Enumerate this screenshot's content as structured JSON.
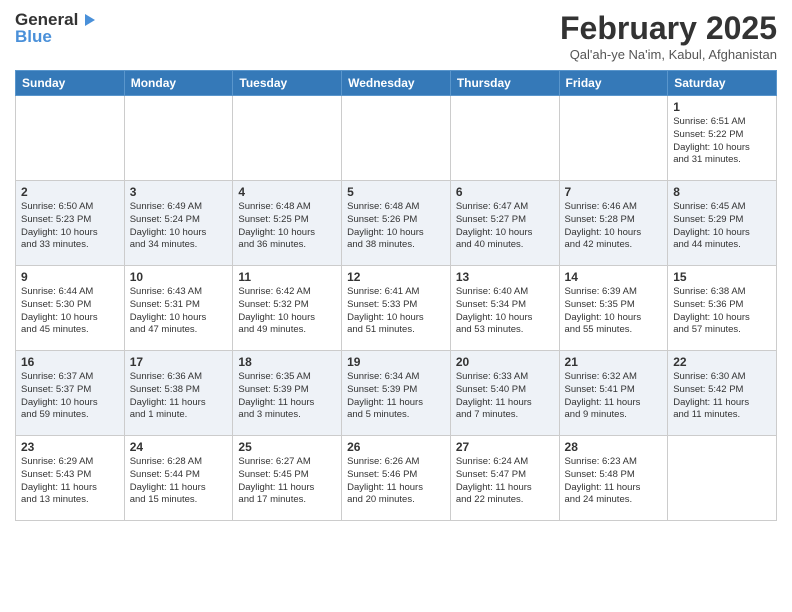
{
  "header": {
    "logo_general": "General",
    "logo_blue": "Blue",
    "month_title": "February 2025",
    "location": "Qal'ah-ye Na'im, Kabul, Afghanistan"
  },
  "days_of_week": [
    "Sunday",
    "Monday",
    "Tuesday",
    "Wednesday",
    "Thursday",
    "Friday",
    "Saturday"
  ],
  "weeks": [
    [
      {
        "day": "",
        "info": ""
      },
      {
        "day": "",
        "info": ""
      },
      {
        "day": "",
        "info": ""
      },
      {
        "day": "",
        "info": ""
      },
      {
        "day": "",
        "info": ""
      },
      {
        "day": "",
        "info": ""
      },
      {
        "day": "1",
        "info": "Sunrise: 6:51 AM\nSunset: 5:22 PM\nDaylight: 10 hours\nand 31 minutes."
      }
    ],
    [
      {
        "day": "2",
        "info": "Sunrise: 6:50 AM\nSunset: 5:23 PM\nDaylight: 10 hours\nand 33 minutes."
      },
      {
        "day": "3",
        "info": "Sunrise: 6:49 AM\nSunset: 5:24 PM\nDaylight: 10 hours\nand 34 minutes."
      },
      {
        "day": "4",
        "info": "Sunrise: 6:48 AM\nSunset: 5:25 PM\nDaylight: 10 hours\nand 36 minutes."
      },
      {
        "day": "5",
        "info": "Sunrise: 6:48 AM\nSunset: 5:26 PM\nDaylight: 10 hours\nand 38 minutes."
      },
      {
        "day": "6",
        "info": "Sunrise: 6:47 AM\nSunset: 5:27 PM\nDaylight: 10 hours\nand 40 minutes."
      },
      {
        "day": "7",
        "info": "Sunrise: 6:46 AM\nSunset: 5:28 PM\nDaylight: 10 hours\nand 42 minutes."
      },
      {
        "day": "8",
        "info": "Sunrise: 6:45 AM\nSunset: 5:29 PM\nDaylight: 10 hours\nand 44 minutes."
      }
    ],
    [
      {
        "day": "9",
        "info": "Sunrise: 6:44 AM\nSunset: 5:30 PM\nDaylight: 10 hours\nand 45 minutes."
      },
      {
        "day": "10",
        "info": "Sunrise: 6:43 AM\nSunset: 5:31 PM\nDaylight: 10 hours\nand 47 minutes."
      },
      {
        "day": "11",
        "info": "Sunrise: 6:42 AM\nSunset: 5:32 PM\nDaylight: 10 hours\nand 49 minutes."
      },
      {
        "day": "12",
        "info": "Sunrise: 6:41 AM\nSunset: 5:33 PM\nDaylight: 10 hours\nand 51 minutes."
      },
      {
        "day": "13",
        "info": "Sunrise: 6:40 AM\nSunset: 5:34 PM\nDaylight: 10 hours\nand 53 minutes."
      },
      {
        "day": "14",
        "info": "Sunrise: 6:39 AM\nSunset: 5:35 PM\nDaylight: 10 hours\nand 55 minutes."
      },
      {
        "day": "15",
        "info": "Sunrise: 6:38 AM\nSunset: 5:36 PM\nDaylight: 10 hours\nand 57 minutes."
      }
    ],
    [
      {
        "day": "16",
        "info": "Sunrise: 6:37 AM\nSunset: 5:37 PM\nDaylight: 10 hours\nand 59 minutes."
      },
      {
        "day": "17",
        "info": "Sunrise: 6:36 AM\nSunset: 5:38 PM\nDaylight: 11 hours\nand 1 minute."
      },
      {
        "day": "18",
        "info": "Sunrise: 6:35 AM\nSunset: 5:39 PM\nDaylight: 11 hours\nand 3 minutes."
      },
      {
        "day": "19",
        "info": "Sunrise: 6:34 AM\nSunset: 5:39 PM\nDaylight: 11 hours\nand 5 minutes."
      },
      {
        "day": "20",
        "info": "Sunrise: 6:33 AM\nSunset: 5:40 PM\nDaylight: 11 hours\nand 7 minutes."
      },
      {
        "day": "21",
        "info": "Sunrise: 6:32 AM\nSunset: 5:41 PM\nDaylight: 11 hours\nand 9 minutes."
      },
      {
        "day": "22",
        "info": "Sunrise: 6:30 AM\nSunset: 5:42 PM\nDaylight: 11 hours\nand 11 minutes."
      }
    ],
    [
      {
        "day": "23",
        "info": "Sunrise: 6:29 AM\nSunset: 5:43 PM\nDaylight: 11 hours\nand 13 minutes."
      },
      {
        "day": "24",
        "info": "Sunrise: 6:28 AM\nSunset: 5:44 PM\nDaylight: 11 hours\nand 15 minutes."
      },
      {
        "day": "25",
        "info": "Sunrise: 6:27 AM\nSunset: 5:45 PM\nDaylight: 11 hours\nand 17 minutes."
      },
      {
        "day": "26",
        "info": "Sunrise: 6:26 AM\nSunset: 5:46 PM\nDaylight: 11 hours\nand 20 minutes."
      },
      {
        "day": "27",
        "info": "Sunrise: 6:24 AM\nSunset: 5:47 PM\nDaylight: 11 hours\nand 22 minutes."
      },
      {
        "day": "28",
        "info": "Sunrise: 6:23 AM\nSunset: 5:48 PM\nDaylight: 11 hours\nand 24 minutes."
      },
      {
        "day": "",
        "info": ""
      }
    ]
  ]
}
